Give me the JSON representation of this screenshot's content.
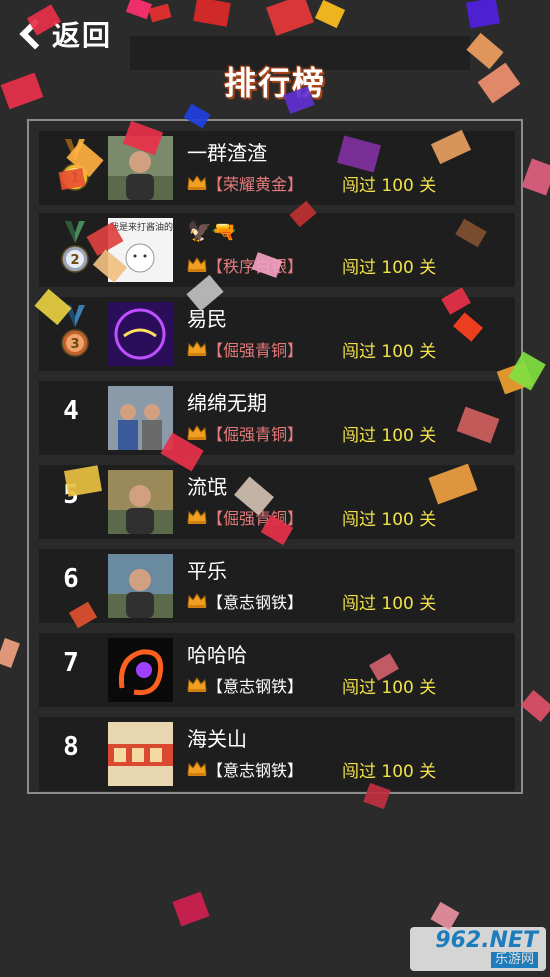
{
  "header": {
    "back_label": "返回",
    "title": "排行榜"
  },
  "ranking": [
    {
      "rank": "1",
      "name": "一群渣渣",
      "tier": "【荣耀黄金】",
      "tier_color": "#e57b7b",
      "level": "闯过 100 关",
      "medal": "gold",
      "avatar": "avatar-photo-man"
    },
    {
      "rank": "2",
      "name": "🦅🔫",
      "tier": "【秩序白银】",
      "tier_color": "#e57b7b",
      "level": "闯过 100 关",
      "medal": "silver",
      "avatar": "avatar-meme-text",
      "avatar_text": "我是来打酱油的"
    },
    {
      "rank": "3",
      "name": "易民",
      "tier": "【倔强青铜】",
      "tier_color": "#e57b7b",
      "level": "闯过 100 关",
      "medal": "bronze",
      "avatar": "avatar-neon-logo"
    },
    {
      "rank": "4",
      "name": "绵绵无期",
      "tier": "【倔强青铜】",
      "tier_color": "#e57b7b",
      "level": "闯过 100 关",
      "medal": "none",
      "avatar": "avatar-photo-kids"
    },
    {
      "rank": "5",
      "name": "流氓",
      "tier": "【倔强青铜】",
      "tier_color": "#e57b7b",
      "level": "闯过 100 关",
      "medal": "none",
      "avatar": "avatar-photo-outdoor"
    },
    {
      "rank": "6",
      "name": "平乐",
      "tier": "【意志钢铁】",
      "tier_color": "#ffffff",
      "level": "闯过 100 关",
      "medal": "none",
      "avatar": "avatar-photo-selfie"
    },
    {
      "rank": "7",
      "name": "哈哈哈",
      "tier": "【意志钢铁】",
      "tier_color": "#ffffff",
      "level": "闯过 100 关",
      "medal": "none",
      "avatar": "avatar-dragon-logo"
    },
    {
      "rank": "8",
      "name": "海关山",
      "tier": "【意志钢铁】",
      "tier_color": "#ffffff",
      "level": "闯过 100 关",
      "medal": "none",
      "avatar": "avatar-sign-text"
    }
  ],
  "watermark": {
    "top": "962.NET",
    "bottom": "乐游网"
  },
  "colors": {
    "background": "#2b2b2b",
    "row": "#1e1e1e",
    "level_text": "#f2e24a",
    "title_outline": "#a24418"
  }
}
